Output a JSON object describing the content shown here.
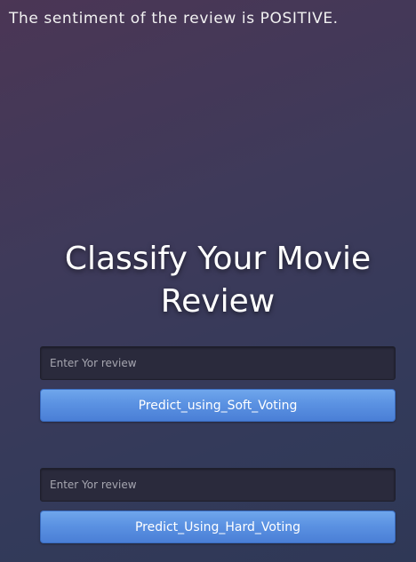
{
  "result": {
    "text": "The sentiment of the review is POSITIVE."
  },
  "header": {
    "title_line1": "Classify Your Movie",
    "title_line2": "Review"
  },
  "form_soft": {
    "review_placeholder": "Enter Yor review",
    "review_value": "",
    "button_label": "Predict_using_Soft_Voting"
  },
  "form_hard": {
    "review_placeholder": "Enter Yor review",
    "review_value": "",
    "button_label": "Predict_Using_Hard_Voting"
  },
  "colors": {
    "button_primary": "#5b92e2",
    "input_background": "#2a2a3c"
  }
}
